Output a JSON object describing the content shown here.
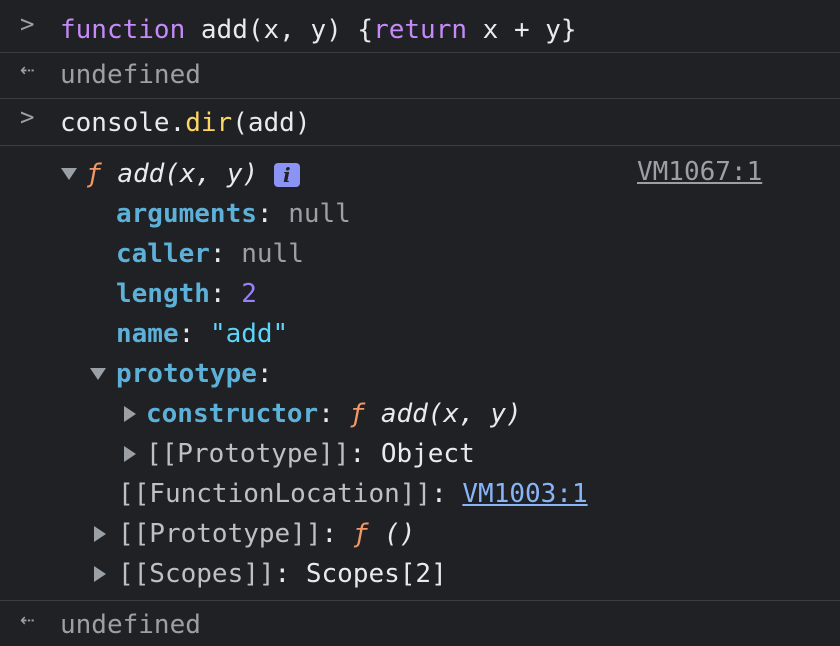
{
  "entries": {
    "input1": {
      "prompt": ">",
      "keyword_function": "function",
      "rest1": " add(x, y) {",
      "keyword_return": "return",
      "rest2": " x + y}"
    },
    "output1": {
      "prompt": "⇠",
      "value": "undefined"
    },
    "input2": {
      "prompt": ">",
      "obj": "console.",
      "method": "dir",
      "args": "(add)"
    },
    "output_tree": {
      "header": {
        "f": "ƒ",
        "signature": "add(x, y)",
        "info": "i",
        "source_link": "VM1067:1"
      },
      "props": [
        {
          "key": "arguments",
          "sep": ": ",
          "value": "null"
        },
        {
          "key": "caller",
          "sep": ": ",
          "value": "null"
        },
        {
          "key": "length",
          "sep": ": ",
          "value": "2"
        },
        {
          "key": "name",
          "sep": ": ",
          "value": "\"add\""
        }
      ],
      "prototype": {
        "key": "prototype",
        "sep": ":",
        "constructor_key": "constructor",
        "constructor_sep": ": ",
        "constructor_f": "ƒ",
        "constructor_sig": "add(x, y)",
        "inner_proto_key": "[[Prototype]]",
        "inner_proto_sep": ": ",
        "inner_proto_value": "Object"
      },
      "function_location": {
        "key": "[[FunctionLocation]]",
        "sep": ": ",
        "link": "VM1003:1"
      },
      "proto": {
        "key": "[[Prototype]]",
        "sep": ": ",
        "f": "ƒ",
        "value": "()"
      },
      "scopes": {
        "key": "[[Scopes]]",
        "sep": ": ",
        "value": "Scopes[2]"
      }
    },
    "output2": {
      "prompt": "⇠",
      "value": "undefined"
    }
  },
  "colors": {
    "background": "#202124",
    "keyword": "#c58af9",
    "method": "#fdd663",
    "property": "#5db0d7",
    "number": "#9980ff",
    "string": "#5cd5fb",
    "function_f": "#f29766",
    "link": "#8ab4f8",
    "info_badge": "#8b93f4"
  }
}
